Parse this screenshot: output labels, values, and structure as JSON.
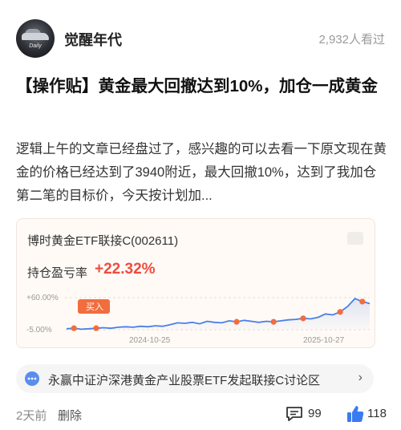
{
  "header": {
    "author": "觉醒年代",
    "avatar_text": "Daily",
    "views": "2,932人看过"
  },
  "post": {
    "title": "【操作贴】黄金最大回撤达到10%，加仓一成黄金",
    "body": "逻辑上午的文章已经盘过了，感兴趣的可以去看一下原文现在黄金的价格已经达到了3940附近，最大回撤10%，达到了我加仓第二笔的目标价，今天按计划加..."
  },
  "fund_card": {
    "name": "博时黄金ETF联接C(002611)",
    "pnl_label": "持仓盈亏率",
    "pnl_value": "+22.32%",
    "buy_tag": "买入",
    "y_top_label": "+60.00%",
    "y_bottom_label": "-5.00%",
    "x_labels": [
      "2024-10-25",
      "2025-10-27"
    ],
    "colors": {
      "line": "#4a7fe8",
      "marker": "#f26d3d",
      "positive": "#f04b3e"
    }
  },
  "chart_data": {
    "type": "line",
    "y_range": [
      -5,
      60
    ],
    "x_ticks": [
      "2024-10-25",
      "2025-10-27"
    ],
    "series": [
      {
        "values": [
          -3,
          -2,
          -4,
          -3,
          -2,
          -1,
          -2,
          0,
          1,
          0,
          2,
          1,
          3,
          2,
          5,
          9,
          8,
          10,
          7,
          12,
          10,
          9,
          13,
          11,
          14,
          12,
          10,
          12,
          11,
          13,
          15,
          16,
          18,
          17,
          20,
          27,
          25,
          31,
          42,
          58,
          52,
          48
        ]
      }
    ],
    "buy_markers_index": [
      1,
      4,
      23,
      28,
      32,
      37,
      40
    ]
  },
  "discussion": {
    "label": "永赢中证沪深港黄金产业股票ETF发起联接C讨论区",
    "arrow": "›"
  },
  "footer": {
    "time": "2天前",
    "delete_label": "删除",
    "comment_count": "99",
    "like_count": "118"
  }
}
